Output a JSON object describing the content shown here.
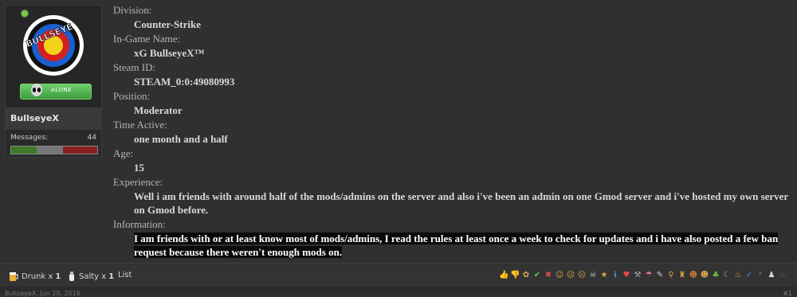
{
  "user": {
    "username": "BullseyeX",
    "badge_text": "ALONE",
    "avatar_text": "BULLSEYE",
    "messages_label": "Messages:",
    "messages_count": "44",
    "bar_colors": [
      "#3c7a2a",
      "#777777",
      "#8b1f1f"
    ]
  },
  "fields": [
    {
      "label": "Division:",
      "value": "Counter-Strike"
    },
    {
      "label": "In-Game Name:",
      "value": "xG BullseyeX™"
    },
    {
      "label": "Steam ID:",
      "value": "STEAM_0:0:49080993"
    },
    {
      "label": "Position:",
      "value": "Moderator"
    },
    {
      "label": "Time Active:",
      "value": "one month and a half"
    },
    {
      "label": "Age:",
      "value": "15"
    },
    {
      "label": "Experience:",
      "value": "Well i am friends with around half of the mods/admins on the server and also i've been an admin on one Gmod server and i've hosted my own server on Gmod before."
    },
    {
      "label": "Information:",
      "value": "I am friends with or at least know most of mods/admins, I read the rules at least once a week to check for updates and i have also posted a few ban request because there weren't enough mods on."
    }
  ],
  "ratings": [
    {
      "name": "Drunk",
      "count": "1"
    },
    {
      "name": "Salty",
      "count": "1"
    }
  ],
  "ratings_list": "List",
  "multiplier": "x",
  "footer_partial": "BullseyeX, Jun 20, 2016",
  "post_number": "#1"
}
